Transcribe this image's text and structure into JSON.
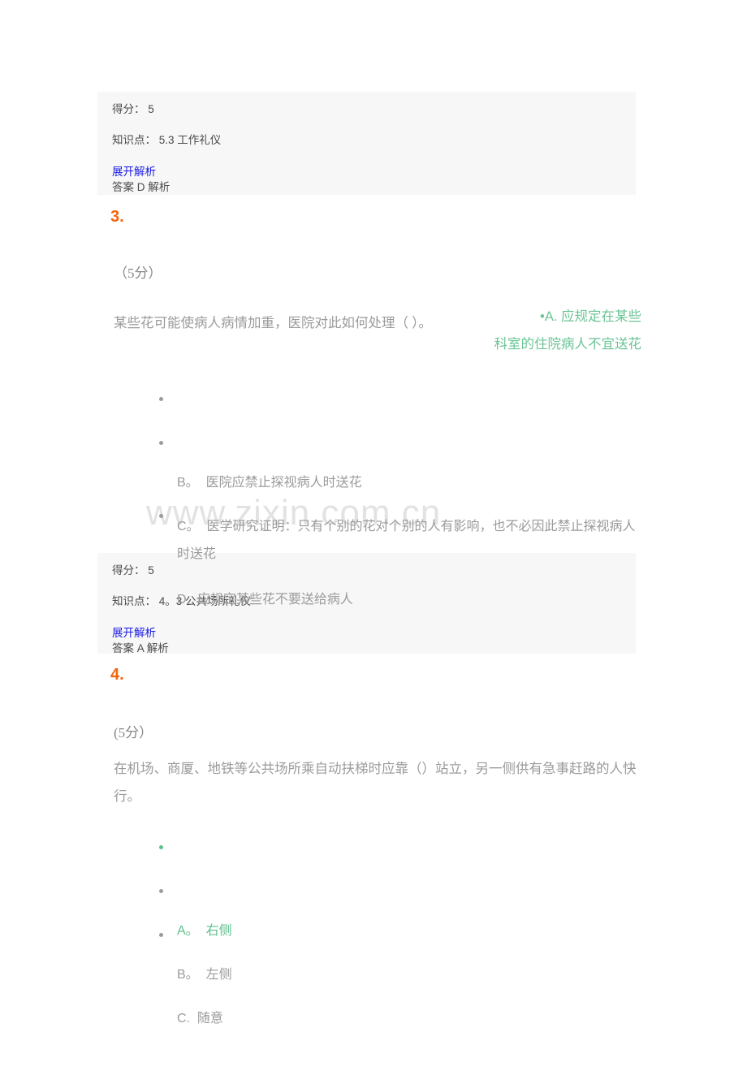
{
  "watermark": "www.zixin.com.cn",
  "labels": {
    "score_prefix": "得分：",
    "knowledge_prefix": "知识点：",
    "expand_analysis": "展开解析",
    "answer_prefix": "答案",
    "analysis_suffix": "解析"
  },
  "blocks": [
    {
      "id": "meta-q2",
      "score_line": "得分： 5",
      "knowledge_line": "知识点： 5.3 工作礼仪",
      "expand_link": "展开解析",
      "answer_line": "答案 D 解析"
    },
    {
      "id": "meta-q3",
      "score_line": "得分： 5",
      "knowledge_line": "知识点： 4。3 公共场所礼仪",
      "expand_link": "展开解析",
      "answer_line": "答案 A 解析"
    }
  ],
  "questions": [
    {
      "number": "3.",
      "points": "（5分）",
      "stem": "某些花可能使病人病情加重，医院对此如何处理（ ）。",
      "inline_answer_line1": "•A. 应规定在某些",
      "inline_answer_line2": "科室的住院病人不宜送花",
      "options": [
        {
          "label": "B。",
          "text": "医院应禁止探视病人时送花",
          "correct": false
        },
        {
          "label": "C。",
          "text": "医学研究证明：只有个别的花对个别的人有影响，也不必因此禁止探视病人时送花",
          "correct": false
        },
        {
          "label": "D.",
          "text": "应规定某些花不要送给病人",
          "correct": false
        }
      ]
    },
    {
      "number": "4.",
      "points": "(5分）",
      "stem": "在机场、商厦、地铁等公共场所乘自动扶梯时应靠（）站立，另一侧供有急事赶路的人快行。",
      "options": [
        {
          "label": "A。",
          "text": "右侧",
          "correct": true
        },
        {
          "label": "B。",
          "text": "左侧",
          "correct": false
        },
        {
          "label": "C.",
          "text": "随意",
          "correct": false
        }
      ]
    }
  ],
  "colors": {
    "orange": "#f4650c",
    "green": "#5ec08d",
    "blue_link": "#1a1ae6",
    "gray_text": "#9b9b9b",
    "meta_bg": "#f7f7f7",
    "watermark": "#e2e2e2"
  }
}
